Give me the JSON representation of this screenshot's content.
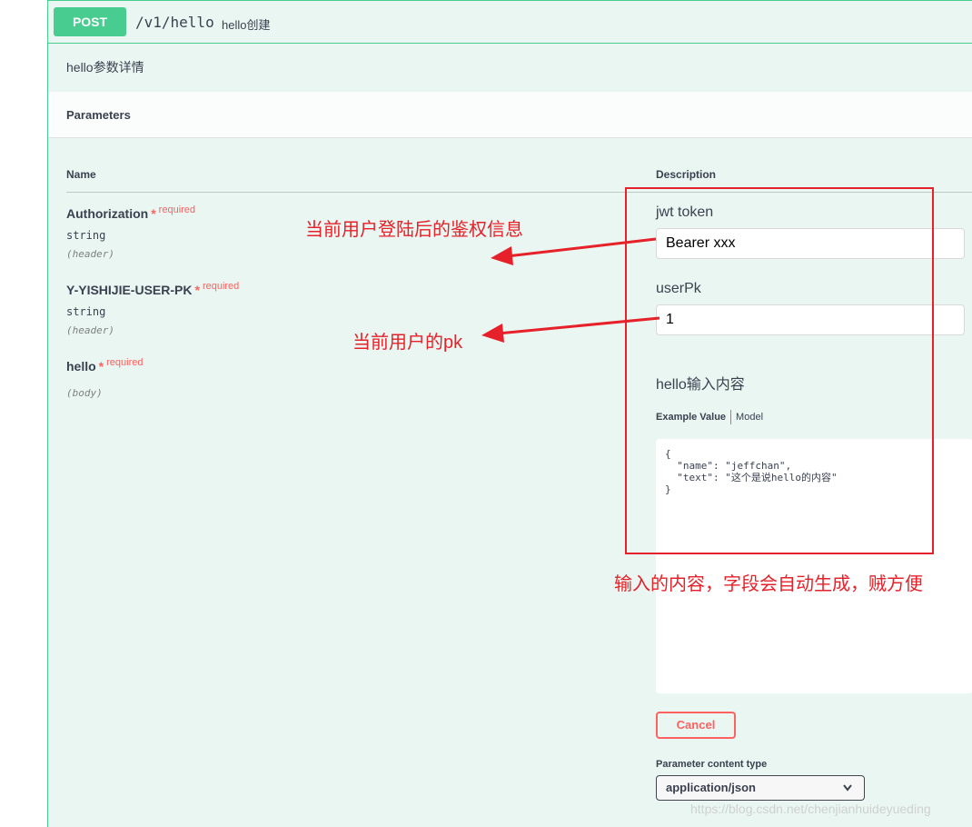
{
  "operation": {
    "method": "POST",
    "path": "/v1/hello",
    "summary": "hello创建",
    "description": "hello参数详情"
  },
  "parameters": {
    "title": "Parameters",
    "columns": {
      "name": "Name",
      "description": "Description"
    },
    "items": [
      {
        "name": "Authorization",
        "star": "*",
        "required": "required",
        "type": "string",
        "in": "(header)",
        "description": "jwt token",
        "value": "Bearer xxx"
      },
      {
        "name": "Y-YISHIJIE-USER-PK",
        "star": "*",
        "required": "required",
        "type": "string",
        "in": "(header)",
        "description": "userPk",
        "value": "1"
      },
      {
        "name": "hello",
        "star": "*",
        "required": "required",
        "in": "(body)",
        "description": "hello输入内容"
      }
    ]
  },
  "body": {
    "tab_example": "Example Value",
    "tab_model": "Model",
    "example": "{\n  \"name\": \"jeffchan\",\n  \"text\": \"这个是说hello的内容\"\n}"
  },
  "cancel_label": "Cancel",
  "content_type": {
    "label": "Parameter content type",
    "value": "application/json"
  },
  "annotations": {
    "auth": "当前用户登陆后的鉴权信息",
    "pk": "当前用户的pk",
    "content": "输入的内容，字段会自动生成，贼方便"
  },
  "watermark": "https://blog.csdn.net/chenjianhuideyueding",
  "colors": {
    "accent": "#49cc90",
    "required": "#ff6060",
    "annotation": "#e62129",
    "background": "#e9f6f1"
  },
  "icons": {
    "select_chevron": "chevron-down-icon"
  }
}
